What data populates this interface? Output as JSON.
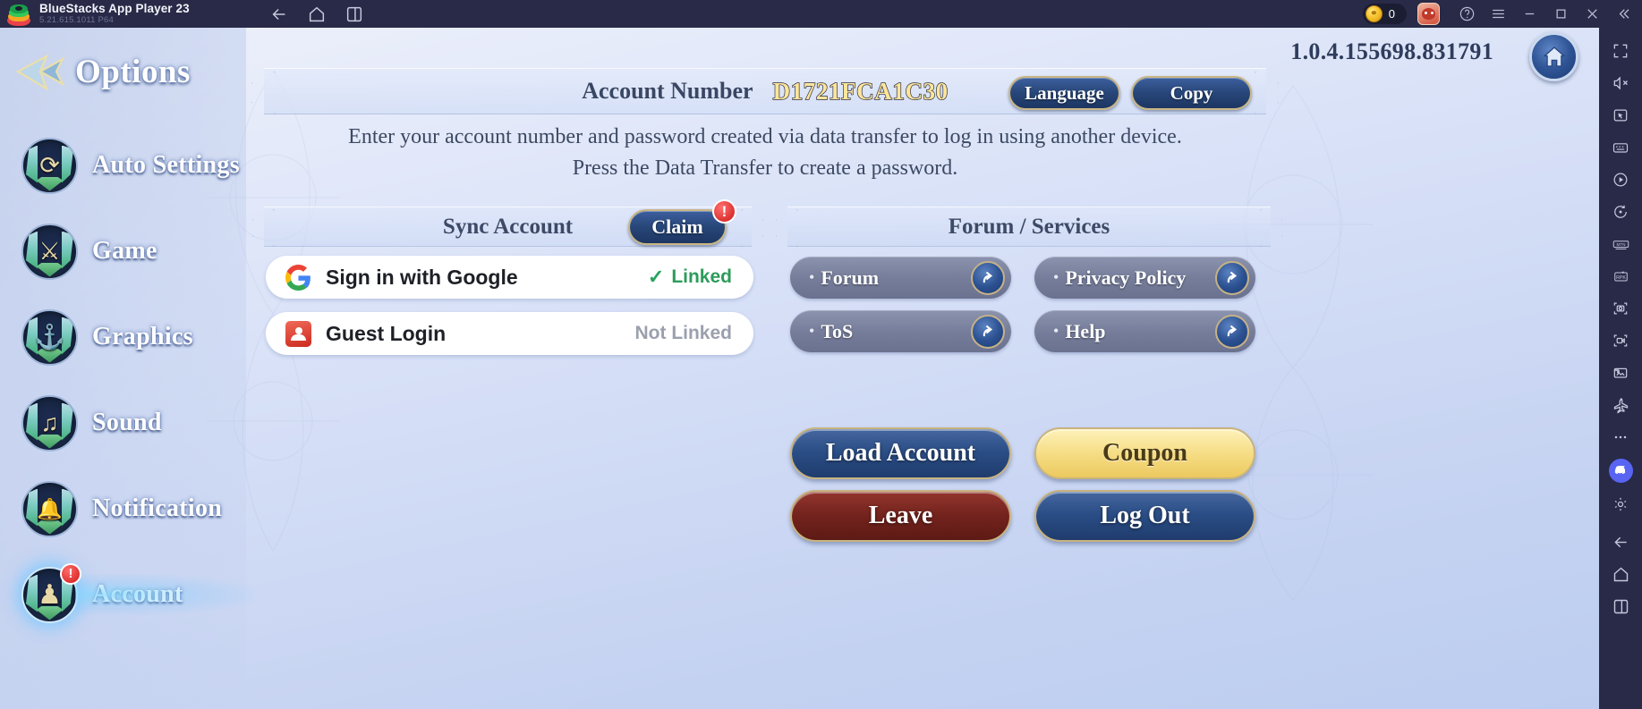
{
  "titlebar": {
    "app_title": "BlueStacks App Player 23",
    "app_version": "5.21.615.1011  P64",
    "nav_icons": [
      "back-arrow-icon",
      "home-icon",
      "multi-instance-icon"
    ],
    "coin_count": "0",
    "right_icons": [
      "help-icon",
      "menu-icon",
      "minimize-icon",
      "maximize-icon",
      "close-icon",
      "collapse-icon"
    ]
  },
  "sidebar": {
    "header": "Options",
    "items": [
      {
        "label": "Auto Settings",
        "icon": "auto-settings-icon",
        "glyph": "⟳",
        "alert": "",
        "active": false
      },
      {
        "label": "Game",
        "icon": "game-swords-icon",
        "glyph": "⚔",
        "alert": "",
        "active": false
      },
      {
        "label": "Graphics",
        "icon": "graphics-icon",
        "glyph": "⚓",
        "alert": "",
        "active": false
      },
      {
        "label": "Sound",
        "icon": "sound-note-icon",
        "glyph": "♫",
        "alert": "",
        "active": false
      },
      {
        "label": "Notification",
        "icon": "notification-bell-icon",
        "glyph": "🔔",
        "alert": "",
        "active": false
      },
      {
        "label": "Account",
        "icon": "account-person-icon",
        "glyph": "♟",
        "alert": "!",
        "active": true
      }
    ]
  },
  "header": {
    "game_version": "1.0.4.155698.831791",
    "home_button": "home-button"
  },
  "account_band": {
    "label": "Account Number",
    "number": "D1721FCA1C30",
    "language_button": "Language",
    "copy_button": "Copy"
  },
  "hint": {
    "line1": "Enter your account number and password created via data transfer to log in using another device.",
    "line2": "Press the Data Transfer to create a password."
  },
  "sync_section": {
    "title": "Sync Account",
    "claim_button": "Claim",
    "claim_alert": "!",
    "rows": [
      {
        "name": "Sign in with Google",
        "icon": "google-icon",
        "status": "Linked",
        "linked": true
      },
      {
        "name": "Guest Login",
        "icon": "guest-person-icon",
        "status": "Not Linked",
        "linked": false
      }
    ]
  },
  "forum_section": {
    "title": "Forum / Services",
    "bullet": "•",
    "items": [
      {
        "label": "Forum",
        "icon": "external-link-icon"
      },
      {
        "label": "Privacy Policy",
        "icon": "external-link-icon"
      },
      {
        "label": "ToS",
        "icon": "external-link-icon"
      },
      {
        "label": "Help",
        "icon": "external-link-icon"
      }
    ]
  },
  "actions": [
    {
      "label": "Load Account",
      "style": "blue"
    },
    {
      "label": "Coupon",
      "style": "gold"
    },
    {
      "label": "Leave",
      "style": "red"
    },
    {
      "label": "Log Out",
      "style": "blue"
    }
  ],
  "rail": {
    "icons": [
      "fullscreen-icon",
      "mute-icon",
      "pointer-icon",
      "keyboard-icon",
      "macro-play-icon",
      "sync-rotate-icon",
      "mmo-controls-icon",
      "rpg-controls-icon",
      "screenshot-icon",
      "record-video-icon",
      "media-gallery-icon",
      "airplane-icon",
      "more-options-icon",
      "discord-icon",
      "settings-gear-icon",
      "back-arrow-icon",
      "home-icon",
      "multi-instance-icon"
    ]
  },
  "colors": {
    "titlebar_bg": "#282a47",
    "accent_blue": "#2a4d85",
    "gold_border": "#c8b37f",
    "linked_green": "#2c9c5b",
    "alert_red": "#cd1818",
    "coupon_gold": "#f6dd86",
    "leave_red": "#74231d"
  }
}
